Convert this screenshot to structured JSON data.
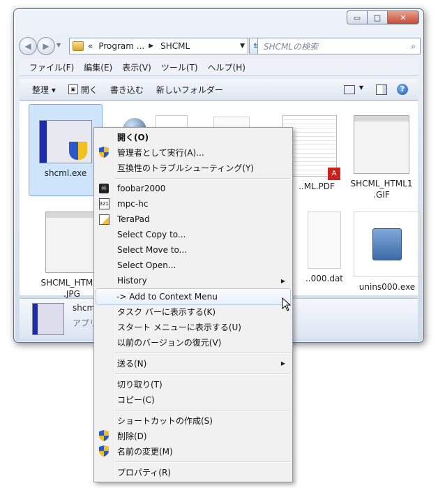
{
  "window": {
    "address": {
      "prefix": "«",
      "crumb1": "Program ...",
      "crumb2": "SHCML"
    },
    "search_placeholder": "SHCMLの検索",
    "caption": {
      "minimize": "▭",
      "maximize": "□",
      "close": "✕"
    }
  },
  "menubar": [
    "ファイル(F)",
    "編集(E)",
    "表示(V)",
    "ツール(T)",
    "ヘルプ(H)"
  ],
  "toolbar": {
    "organize": "整理 ▾",
    "open": "開く",
    "burn": "書き込む",
    "new_folder": "新しいフォルダー"
  },
  "files": [
    {
      "name": "shcml.exe"
    },
    {
      "name": "..ML.PDF"
    },
    {
      "name": "SHCML_HTML1\n.GIF"
    },
    {
      "name": "SHCML_HTML2\n.JPG"
    },
    {
      "name": "..000.dat"
    },
    {
      "name": "unins000.exe"
    }
  ],
  "details": {
    "name": "shcm",
    "type": "アプリ"
  },
  "context_menu": {
    "items": [
      {
        "label": "開く(O)",
        "icon": "none",
        "bold": true
      },
      {
        "label": "管理者として実行(A)...",
        "icon": "uac-shield-icon"
      },
      {
        "label": "互換性のトラブルシューティング(Y)",
        "icon": "none"
      },
      {
        "label": "foobar2000",
        "icon": "foobar-icon"
      },
      {
        "label": "mpc-hc",
        "icon": "mpc-icon"
      },
      {
        "label": "TeraPad",
        "icon": "terapad-icon"
      },
      {
        "label": "Select Copy to...",
        "icon": "none"
      },
      {
        "label": "Select Move to...",
        "icon": "none"
      },
      {
        "label": "Select Open...",
        "icon": "none"
      },
      {
        "label": "History",
        "icon": "none",
        "submenu": true
      },
      {
        "label": "-> Add to Context Menu",
        "icon": "none",
        "hover": true
      },
      {
        "label": "タスク バーに表示する(K)",
        "icon": "none"
      },
      {
        "label": "スタート メニューに表示する(U)",
        "icon": "none"
      },
      {
        "label": "以前のバージョンの復元(V)",
        "icon": "none"
      },
      {
        "label": "送る(N)",
        "icon": "none",
        "submenu": true
      },
      {
        "label": "切り取り(T)",
        "icon": "none"
      },
      {
        "label": "コピー(C)",
        "icon": "none"
      },
      {
        "label": "ショートカットの作成(S)",
        "icon": "none"
      },
      {
        "label": "削除(D)",
        "icon": "uac-shield-icon"
      },
      {
        "label": "名前の変更(M)",
        "icon": "uac-shield-icon"
      },
      {
        "label": "プロパティ(R)",
        "icon": "none"
      }
    ]
  },
  "colors": {
    "accent": "#2a6db7",
    "selection": "#cfe5fb",
    "menu_bg": "#f1f1f1"
  }
}
